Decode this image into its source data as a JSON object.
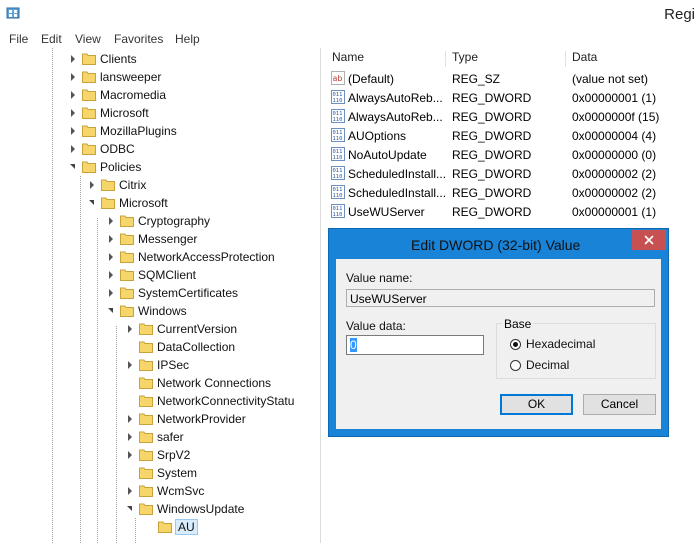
{
  "window": {
    "title": "Regi"
  },
  "menu": [
    "File",
    "Edit",
    "View",
    "Favorites",
    "Help"
  ],
  "tree": {
    "items": [
      {
        "label": "Clients",
        "expander": "collapsed"
      },
      {
        "label": "lansweeper",
        "expander": "collapsed"
      },
      {
        "label": "Macromedia",
        "expander": "collapsed"
      },
      {
        "label": "Microsoft",
        "expander": "collapsed"
      },
      {
        "label": "MozillaPlugins",
        "expander": "collapsed"
      },
      {
        "label": "ODBC",
        "expander": "collapsed"
      },
      {
        "label": "Policies",
        "expander": "expanded"
      },
      {
        "label": "Citrix",
        "expander": "collapsed"
      },
      {
        "label": "Microsoft",
        "expander": "expanded"
      },
      {
        "label": "Cryptography",
        "expander": "collapsed"
      },
      {
        "label": "Messenger",
        "expander": "collapsed"
      },
      {
        "label": "NetworkAccessProtection",
        "expander": "collapsed"
      },
      {
        "label": "SQMClient",
        "expander": "collapsed"
      },
      {
        "label": "SystemCertificates",
        "expander": "collapsed"
      },
      {
        "label": "Windows",
        "expander": "expanded"
      },
      {
        "label": "CurrentVersion",
        "expander": "collapsed"
      },
      {
        "label": "DataCollection",
        "expander": "none"
      },
      {
        "label": "IPSec",
        "expander": "collapsed"
      },
      {
        "label": "Network Connections",
        "expander": "none"
      },
      {
        "label": "NetworkConnectivityStatu",
        "expander": "none"
      },
      {
        "label": "NetworkProvider",
        "expander": "collapsed"
      },
      {
        "label": "safer",
        "expander": "collapsed"
      },
      {
        "label": "SrpV2",
        "expander": "collapsed"
      },
      {
        "label": "System",
        "expander": "none"
      },
      {
        "label": "WcmSvc",
        "expander": "collapsed"
      },
      {
        "label": "WindowsUpdate",
        "expander": "expanded"
      },
      {
        "label": "AU",
        "expander": "none",
        "selected": true
      }
    ]
  },
  "list": {
    "headers": {
      "name": "Name",
      "type": "Type",
      "data": "Data"
    },
    "rows": [
      {
        "icon": "string-value-icon",
        "name": "(Default)",
        "type": "REG_SZ",
        "data": "(value not set)"
      },
      {
        "icon": "dword-value-icon",
        "name": "AlwaysAutoReb...",
        "type": "REG_DWORD",
        "data": "0x00000001 (1)"
      },
      {
        "icon": "dword-value-icon",
        "name": "AlwaysAutoReb...",
        "type": "REG_DWORD",
        "data": "0x0000000f (15)"
      },
      {
        "icon": "dword-value-icon",
        "name": "AUOptions",
        "type": "REG_DWORD",
        "data": "0x00000004 (4)"
      },
      {
        "icon": "dword-value-icon",
        "name": "NoAutoUpdate",
        "type": "REG_DWORD",
        "data": "0x00000000 (0)"
      },
      {
        "icon": "dword-value-icon",
        "name": "ScheduledInstall...",
        "type": "REG_DWORD",
        "data": "0x00000002 (2)"
      },
      {
        "icon": "dword-value-icon",
        "name": "ScheduledInstall...",
        "type": "REG_DWORD",
        "data": "0x00000002 (2)"
      },
      {
        "icon": "dword-value-icon",
        "name": "UseWUServer",
        "type": "REG_DWORD",
        "data": "0x00000001 (1)"
      }
    ]
  },
  "dialog": {
    "title": "Edit DWORD (32-bit) Value",
    "value_name_label": "Value name:",
    "value_name": "UseWUServer",
    "value_data_label": "Value data:",
    "value_data": "0",
    "base_label": "Base",
    "base_options": [
      {
        "label": "Hexadecimal",
        "selected": true
      },
      {
        "label": "Decimal",
        "selected": false
      }
    ],
    "ok_label": "OK",
    "cancel_label": "Cancel"
  },
  "colors": {
    "dialog_frame": "#1883d7",
    "close_button": "#c75050",
    "selection": "#d9ecfb"
  }
}
